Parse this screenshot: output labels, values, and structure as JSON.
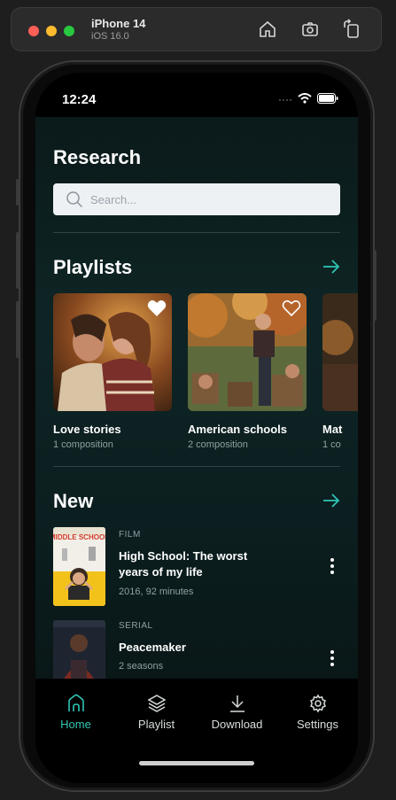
{
  "simulator": {
    "device": "iPhone 14",
    "os": "iOS 16.0",
    "icons": [
      "home-icon",
      "screenshot-icon",
      "rotate-icon"
    ]
  },
  "status_bar": {
    "time": "12:24",
    "icons": [
      "signal-icon",
      "wifi-icon",
      "battery-icon"
    ]
  },
  "page": {
    "title": "Research",
    "search_placeholder": "Search..."
  },
  "playlists": {
    "title": "Playlists",
    "items": [
      {
        "title": "Love stories",
        "subtitle": "1 composition",
        "favorite": true
      },
      {
        "title": "American schools",
        "subtitle": "2 composition",
        "favorite": false
      },
      {
        "title": "Mat",
        "subtitle": "1 co",
        "favorite": false
      }
    ]
  },
  "new_section": {
    "title": "New",
    "items": [
      {
        "type": "FILM",
        "title": "High School: The worst years of my life",
        "meta": "2016, 92 minutes",
        "poster_text": "MIDDLE SCHOOL"
      },
      {
        "type": "SERIAL",
        "title": "Peacemaker",
        "meta": "2 seasons"
      }
    ]
  },
  "tabbar": {
    "items": [
      {
        "label": "Home",
        "icon": "home-icon",
        "active": true
      },
      {
        "label": "Playlist",
        "icon": "layers-icon",
        "active": false
      },
      {
        "label": "Download",
        "icon": "download-icon",
        "active": false
      },
      {
        "label": "Settings",
        "icon": "gear-icon",
        "active": false
      }
    ]
  },
  "colors": {
    "accent": "#2fc5b4",
    "background": "#0e2424",
    "search_bg": "#eef1f4"
  }
}
